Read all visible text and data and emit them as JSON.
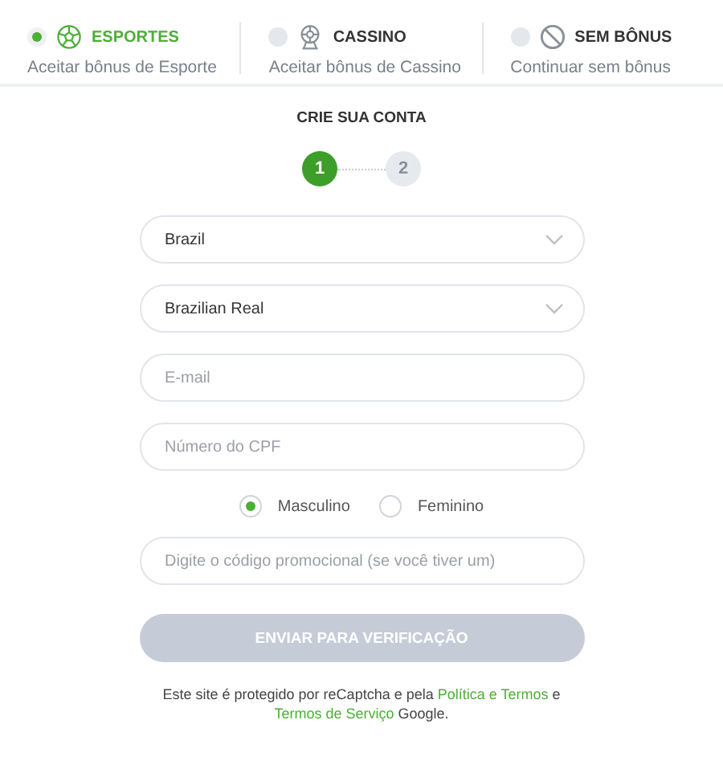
{
  "bonus_options": [
    {
      "kind": "sports",
      "title": "ESPORTES",
      "subtitle": "Aceitar bônus de Esporte",
      "selected": true
    },
    {
      "kind": "casino",
      "title": "CASSINO",
      "subtitle": "Aceitar bônus de Cassino",
      "selected": false
    },
    {
      "kind": "none",
      "title": "SEM BÔNUS",
      "subtitle": "Continuar sem bônus",
      "selected": false
    }
  ],
  "form_title": "CRIE SUA CONTA",
  "steps": [
    {
      "label": "1",
      "selected": true
    },
    {
      "label": "2",
      "selected": false
    }
  ],
  "fields": [
    {
      "kind": "select",
      "value": "Brazil"
    },
    {
      "kind": "select",
      "value": "Brazilian Real"
    },
    {
      "kind": "input",
      "placeholder": "E-mail"
    },
    {
      "kind": "input",
      "placeholder": "Número do CPF"
    }
  ],
  "gender": [
    {
      "label": "Masculino",
      "selected": true
    },
    {
      "label": "Feminino",
      "selected": false
    }
  ],
  "promo_field": {
    "placeholder": "Digite o código promocional (se você tiver um)"
  },
  "submit_button": {
    "label": "ENVIAR PARA VERIFICAÇÃO",
    "disabled": true
  },
  "footer": [
    {
      "kind": "text",
      "text": "Este site é protegido por reCaptcha e pela "
    },
    {
      "kind": "link",
      "text": "Política e Termos"
    },
    {
      "kind": "text",
      "text": " e "
    },
    {
      "kind": "link",
      "text": "Termos de Serviço"
    },
    {
      "kind": "text",
      "text": " Google."
    }
  ]
}
